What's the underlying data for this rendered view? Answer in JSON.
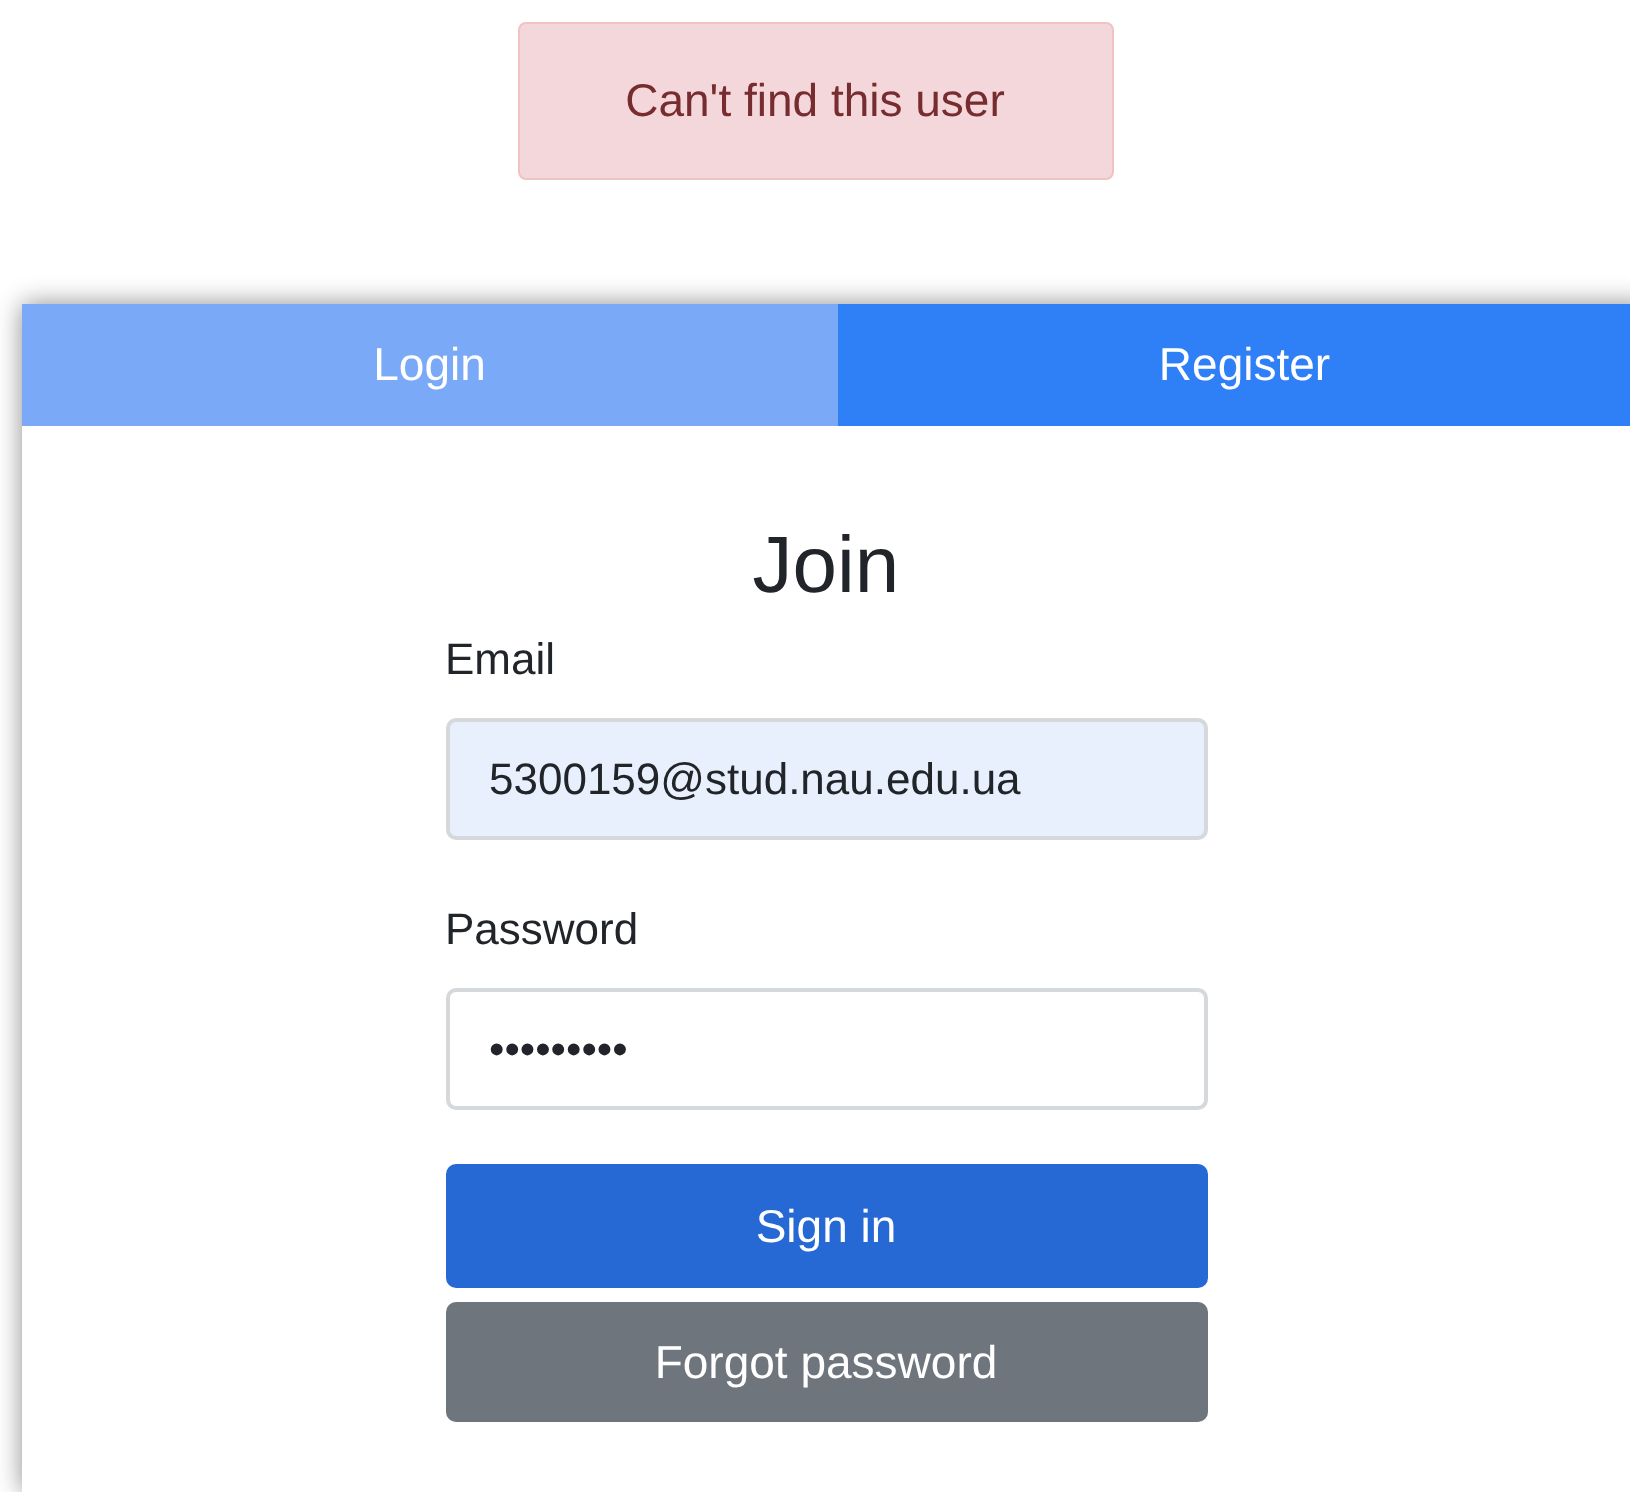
{
  "alert": {
    "text": "Can't find this user"
  },
  "tabs": [
    {
      "label": "Login",
      "selected": true
    },
    {
      "label": "Register",
      "selected": false
    }
  ],
  "form": {
    "title": "Join",
    "fields": [
      {
        "label": "Email",
        "value": "5300159@stud.nau.edu.ua",
        "autofilled": true
      },
      {
        "label": "Password",
        "value": "•••••••••",
        "autofilled": false
      }
    ],
    "buttons": [
      {
        "label": "Sign in",
        "kind": "primary"
      },
      {
        "label": "Forgot password",
        "kind": "secondary"
      }
    ]
  }
}
